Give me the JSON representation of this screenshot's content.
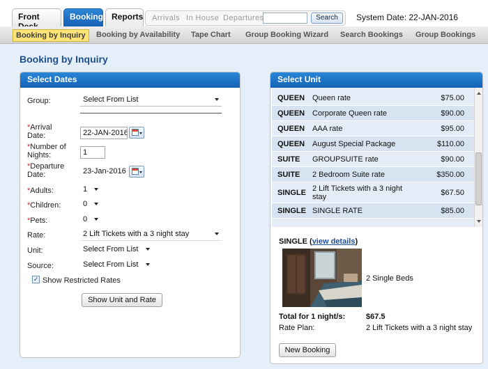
{
  "top_tabs": {
    "front_desk": "Front Desk",
    "booking": "Booking",
    "reports": "Reports"
  },
  "quick_nav": {
    "arrivals": "Arrivals",
    "in_house": "In House",
    "departures": "Departures",
    "search_value": "",
    "search_button": "Search"
  },
  "system_date": "System Date: 22-JAN-2016",
  "sub_nav": [
    "Booking by Inquiry",
    "Booking by Availability",
    "Tape Chart",
    "Group Booking Wizard",
    "Search Bookings",
    "Group Bookings"
  ],
  "page_title": "Booking by Inquiry",
  "select_dates": {
    "title": "Select Dates",
    "group_label": "Group:",
    "group_value": "Select From List",
    "arrival_label_1": "Arrival",
    "arrival_label_2": "Date:",
    "arrival_value": "22-JAN-2016",
    "nights_label_1": "Number of",
    "nights_label_2": "Nights:",
    "nights_value": "1",
    "departure_label_1": "Departure",
    "departure_label_2": "Date:",
    "departure_value": "23-Jan-2016",
    "adults_label": "Adults:",
    "adults_value": "1",
    "children_label": "Children:",
    "children_value": "0",
    "pets_label": "Pets:",
    "pets_value": "0",
    "rate_label": "Rate:",
    "rate_value": "2 Lift Tickets with a 3 night stay",
    "unit_label": "Unit:",
    "unit_value": "Select From List",
    "source_label": "Source:",
    "source_value": "Select From List",
    "restricted_label": "Show Restricted Rates",
    "restricted_checked": true,
    "show_button": "Show Unit and Rate",
    "required_marker": "*"
  },
  "select_unit": {
    "title": "Select Unit",
    "rows": [
      {
        "type": "QUEEN",
        "rate": "Queen rate",
        "price": "$75.00"
      },
      {
        "type": "QUEEN",
        "rate": "Corporate Queen rate",
        "price": "$90.00"
      },
      {
        "type": "QUEEN",
        "rate": "AAA rate",
        "price": "$95.00"
      },
      {
        "type": "QUEEN",
        "rate": "August Special Package",
        "price": "$110.00"
      },
      {
        "type": "SUITE",
        "rate": "GROUPSUITE rate",
        "price": "$90.00"
      },
      {
        "type": "SUITE",
        "rate": "2 Bedroom Suite rate",
        "price": "$350.00"
      },
      {
        "type": "SINGLE",
        "rate": "2 Lift Tickets with a 3 night stay",
        "price": "$67.50"
      },
      {
        "type": "SINGLE",
        "rate": "SINGLE RATE",
        "price": "$85.00"
      }
    ],
    "selected_type": "SINGLE",
    "view_details": "view details",
    "beds": "2 Single Beds",
    "total_label": "Total for 1 night/s:",
    "total_value": "$67.5",
    "rate_plan_label": "Rate Plan:",
    "rate_plan_value": "2 Lift Tickets with a 3 night stay",
    "new_booking_button": "New Booking"
  }
}
